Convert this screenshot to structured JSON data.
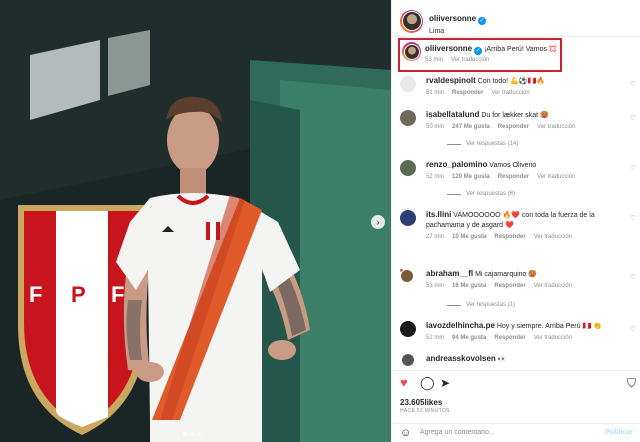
{
  "post": {
    "author": "oliiversonne",
    "location": "Lima"
  },
  "caption": {
    "user": "oliiversonne",
    "text": "¡Arriba Perú! Vamos 💢",
    "time": "53 min",
    "translate": "Ver traducción"
  },
  "comments": [
    {
      "user": "rvaldespinolt",
      "text": "Con todo! 💪⚽🇵🇪🔥",
      "time": "51 min",
      "likes": "",
      "reply": "Responder",
      "translate": "Ver traducción",
      "replies": "",
      "avatar_color": "#e9e9e9"
    },
    {
      "user": "isabellatalund",
      "text": "Du for lækker skat 🥵",
      "time": "50 min",
      "likes": "247 Me gusta",
      "reply": "Responder",
      "translate": "Ver traducción",
      "replies": "Ver respuestas (14)",
      "avatar_color": "#6f6a5c"
    },
    {
      "user": "renzo_palomino",
      "text": "Vamos Oliverio",
      "time": "52 min",
      "likes": "120 Me gusta",
      "reply": "Responder",
      "translate": "Ver traducción",
      "replies": "Ver respuestas (6)",
      "avatar_color": "#5a6b52"
    },
    {
      "user": "its.llini",
      "text": "VAMOOOOOO 🔥❤️ con toda la fuerza de la pachamama y de asgard ❤️",
      "time": "27 min",
      "likes": "10 Me gusta",
      "reply": "Responder",
      "translate": "Ver traducción",
      "replies": "",
      "avatar_color": "#2c3e75"
    },
    {
      "user": "abraham__fl",
      "text": "Mi cajamarquino 🥵",
      "time": "53 min",
      "likes": "16 Me gusta",
      "reply": "Responder",
      "translate": "Ver traducción",
      "replies": "Ver respuestas (1)",
      "avatar_color": "#7a5a3a"
    },
    {
      "user": "lavozdelhincha.pe",
      "text": "Hoy y siempre. Arriba Perú 🇵🇪 👏",
      "time": "52 min",
      "likes": "94 Me gusta",
      "reply": "Responder",
      "translate": "Ver traducción",
      "replies": "",
      "avatar_color": "#1b1b1b"
    },
    {
      "user": "andreasskovolsen",
      "text": "👀",
      "time": "",
      "likes": "",
      "reply": "",
      "translate": "",
      "replies": "",
      "avatar_color": "#555"
    }
  ],
  "footer": {
    "likes": "23.605likes",
    "time": "HACE 53 MINUTOS",
    "add_placeholder": "Agrega un comentario...",
    "publish": "Publicar"
  },
  "photo": {
    "crest_letters": [
      "F",
      "P",
      "F"
    ]
  },
  "colors": {
    "verified": "#0095f6",
    "highlight_border": "#d01f2f",
    "like_red": "#ed4956",
    "jersey_stripe": "#e05a2a"
  }
}
